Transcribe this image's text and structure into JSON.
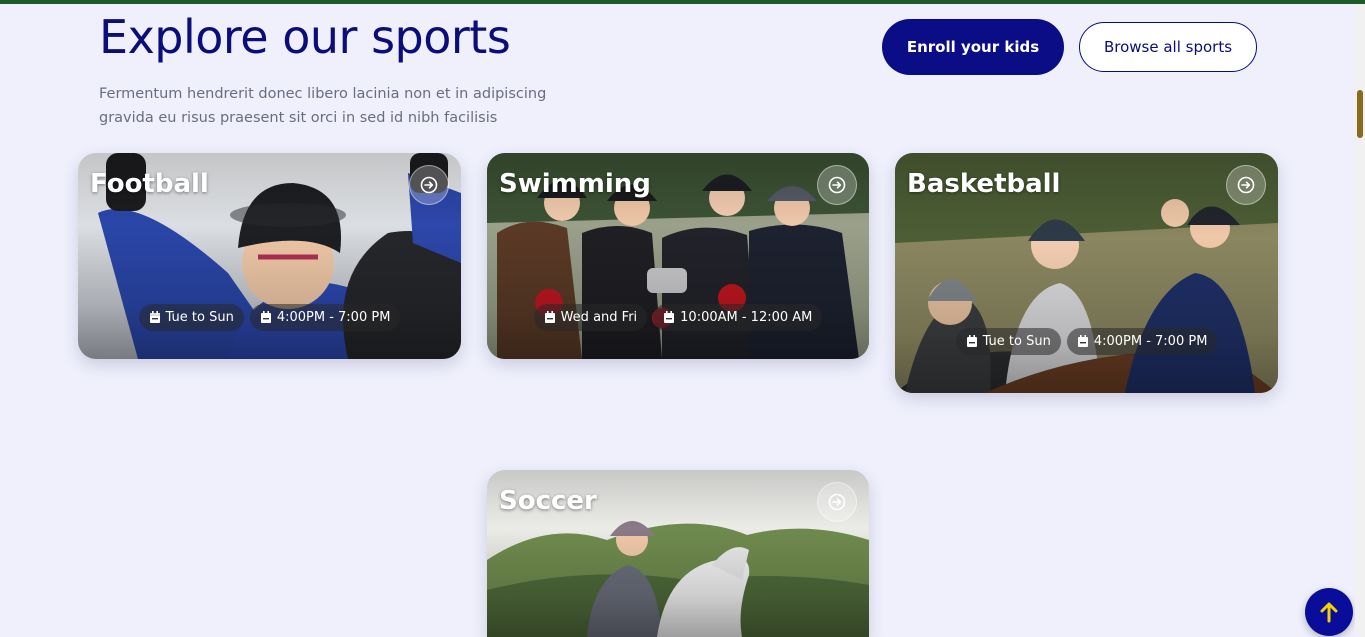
{
  "header": {
    "title": "Explore our sports",
    "subtitle": "Fermentum hendrerit donec libero lacinia non et in adipiscing gravida eu risus praesent sit orci in sed id nibh facilisis",
    "enroll_label": "Enroll your kids",
    "browse_label": "Browse all sports"
  },
  "cards": [
    {
      "title": "Football",
      "days": "Tue to Sun",
      "time": "4:00PM - 7:00 PM",
      "icon": "arrow-circle-right-icon"
    },
    {
      "title": "Swimming",
      "days": "Wed and Fri",
      "time": "10:00AM - 12:00 AM",
      "icon": "arrow-circle-right-icon"
    },
    {
      "title": "Basketball",
      "days": "Tue to Sun",
      "time": "4:00PM - 7:00 PM",
      "icon": "arrow-circle-right-icon"
    },
    {
      "title": "Soccer",
      "days": "",
      "time": "",
      "icon": "arrow-circle-right-icon"
    }
  ],
  "colors": {
    "accent": "#0a0d85",
    "background": "#eff0fc",
    "top_stripe": "#1f5a2b",
    "to_top_arrow": "#f2d300"
  },
  "to_top_icon": "arrow-up-icon"
}
